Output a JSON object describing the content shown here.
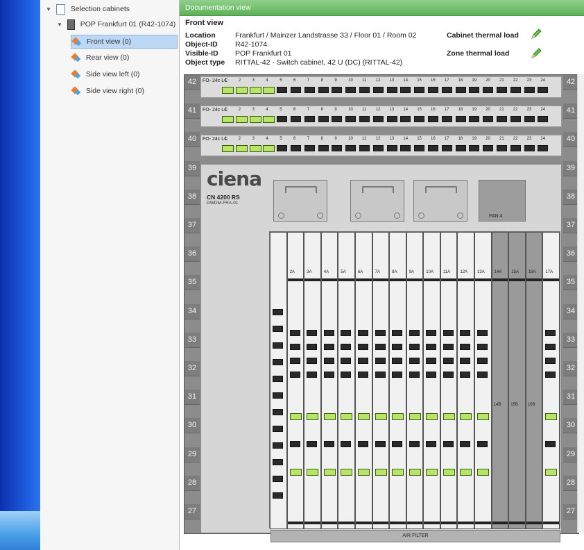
{
  "tree": {
    "root": "Selection cabinets",
    "cabinet": "POP Frankfurt 01 (R42-1074)",
    "views": [
      {
        "label": "Front view (0)",
        "selected": true
      },
      {
        "label": "Rear view (0)",
        "selected": false
      },
      {
        "label": "Side view left (0)",
        "selected": false
      },
      {
        "label": "Side view right (0)",
        "selected": false
      }
    ]
  },
  "doc": {
    "header": "Documentation view",
    "title": "Front view",
    "location_label": "Location",
    "location": "Frankfurt / Mainzer Landstrasse 33 / Floor 01 / Room 02",
    "object_id_label": "Object-ID",
    "object_id": "R42-1074",
    "visible_id_label": "Visible-ID",
    "visible_id": "POP Frankfurt 01",
    "object_type_label": "Object type",
    "object_type": "RITTAL-42 - Switch cabinet, 42 U (DC) (RITTAL-42)",
    "cabinet_load_label": "Cabinet thermal load",
    "zone_load_label": "Zone thermal load"
  },
  "rack": {
    "units": [
      "42",
      "41",
      "40",
      "39",
      "38",
      "37",
      "36",
      "35",
      "34",
      "33",
      "32",
      "31",
      "30",
      "29",
      "28",
      "27"
    ],
    "patch_panel_label": "FO- 24c LC",
    "port_numbers": [
      "1",
      "2",
      "3",
      "4",
      "5",
      "6",
      "7",
      "8",
      "9",
      "10",
      "11",
      "12",
      "13",
      "14",
      "15",
      "16",
      "17",
      "18",
      "19",
      "20",
      "21",
      "22",
      "23",
      "24"
    ],
    "brand": "ciena",
    "model": "CN 4200 RS",
    "model_sub": "DWDM-FRA-01",
    "fan_label": "FAN 4",
    "slot_labels": [
      "2A",
      "3A",
      "4A",
      "5A",
      "6A",
      "7A",
      "8A",
      "9A",
      "10A",
      "11A",
      "12A",
      "13A",
      "14A",
      "15A",
      "16A",
      "17A"
    ],
    "bottom_slots": [
      "14B",
      "15B",
      "16B"
    ],
    "air_filter": "AIR FILTER"
  },
  "colors": {
    "header_green": "#5db259",
    "port_green": "#b6e56a",
    "selection": "#bcd8f4"
  }
}
